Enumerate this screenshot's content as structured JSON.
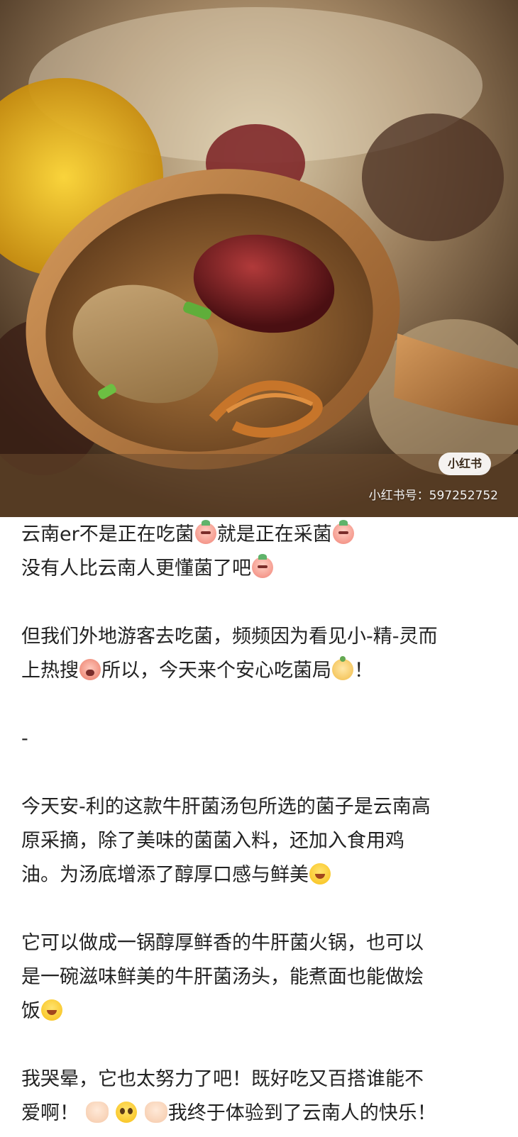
{
  "photo": {
    "watermark_logo": "小红书",
    "watermark_id": "小红书号：597252752"
  },
  "post": {
    "p1_line1_a": "云南er不是正在吃菌",
    "p1_line1_emoji1": "mushroom-emoji",
    "p1_line1_b": "就是正在采菌",
    "p1_line1_emoji2": "mushroom-emoji",
    "p1_line2_a": "没有人比云南人更懂菌了吧",
    "p1_line2_emoji": "mushroom-thinking-emoji",
    "p2_line1": "但我们外地游客去吃菌，频频因为看见小-精-灵而",
    "p2_line2_a": "上热搜",
    "p2_line2_emoji1": "mushroom-crying-emoji",
    "p2_line2_b": "所以，今天来个安心吃菌局",
    "p2_line2_emoji2": "bun-emoji",
    "p2_line2_c": "！",
    "divider": "-",
    "p3_line1": "今天安-利的这款牛肝菌汤包所选的菌子是云南高",
    "p3_line2": "原采摘，除了美味的菌菌入料，还加入食用鸡",
    "p3_line3_a": "油。为汤底增添了醇厚口感与鲜美",
    "p3_line3_emoji": "drooling-face-emoji",
    "p4_line1": "它可以做成一锅醇厚鲜香的牛肝菌火锅，也可以",
    "p4_line2": "是一碗滋味鲜美的牛肝菌汤头，能煮面也能做烩",
    "p4_line3_a": "饭",
    "p4_line3_emoji": "yum-face-emoji",
    "p5_line1": "我哭晕，它也太努力了吧！既好吃又百搭谁能不",
    "p5_line2_a": "爱啊！",
    "p5_line2_emoji1": "fist-emoji",
    "p5_line2_emoji2": "pleading-face-emoji",
    "p5_line2_emoji3": "fist-emoji",
    "p5_line2_b": "我终于体验到了云南人的快乐！"
  }
}
